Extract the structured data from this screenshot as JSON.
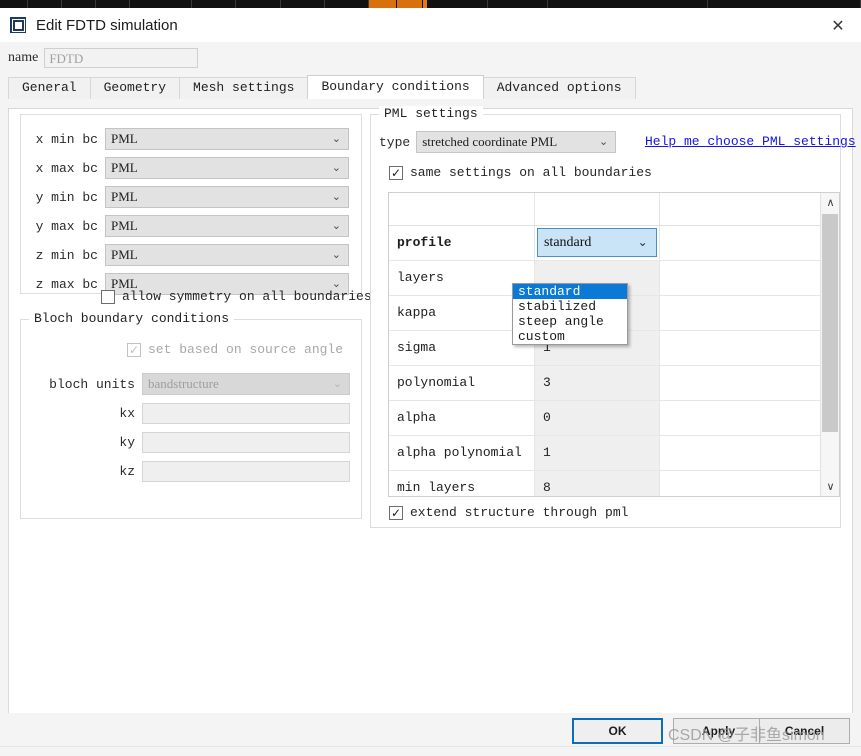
{
  "window": {
    "title": "Edit FDTD simulation",
    "app_icon": "square-window-icon",
    "close_label": "✕"
  },
  "name_row": {
    "label": "name",
    "value": "FDTD"
  },
  "tabs": [
    {
      "label": "General",
      "active": false
    },
    {
      "label": "Geometry",
      "active": false
    },
    {
      "label": "Mesh settings",
      "active": false
    },
    {
      "label": "Boundary conditions",
      "active": true
    },
    {
      "label": "Advanced options",
      "active": false
    }
  ],
  "boundary_conditions": {
    "rows": [
      {
        "label": "x min bc",
        "value": "PML"
      },
      {
        "label": "x max bc",
        "value": "PML"
      },
      {
        "label": "y min bc",
        "value": "PML"
      },
      {
        "label": "y max bc",
        "value": "PML"
      },
      {
        "label": "z min bc",
        "value": "PML"
      },
      {
        "label": "z max bc",
        "value": "PML"
      }
    ],
    "allow_symmetry": {
      "label": "allow symmetry on all boundaries",
      "checked": false,
      "mark": ""
    }
  },
  "bloch": {
    "legend": "Bloch boundary conditions",
    "set_based": {
      "label": "set based on source angle",
      "checked": true,
      "mark": "✓"
    },
    "units_label": "bloch units",
    "units_value": "bandstructure",
    "fields": [
      {
        "label": "kx",
        "value": ""
      },
      {
        "label": "ky",
        "value": ""
      },
      {
        "label": "kz",
        "value": ""
      }
    ]
  },
  "pml": {
    "legend": "PML settings",
    "type_label": "type",
    "type_value": "stretched coordinate PML",
    "help_link": "Help me choose PML settings",
    "same_settings": {
      "label": "same settings on all boundaries",
      "checked": true,
      "mark": "✓"
    },
    "table": {
      "header": [
        "",
        "",
        ""
      ],
      "rows": [
        {
          "name": "profile",
          "value": "standard",
          "is_dropdown": true
        },
        {
          "name": "layers",
          "value": ""
        },
        {
          "name": "kappa",
          "value": ""
        },
        {
          "name": "sigma",
          "value": "1"
        },
        {
          "name": "polynomial",
          "value": "3"
        },
        {
          "name": "alpha",
          "value": "0"
        },
        {
          "name": "alpha polynomial",
          "value": "1"
        },
        {
          "name": "min layers",
          "value": "8"
        }
      ]
    },
    "dropdown_options": [
      {
        "label": "standard",
        "selected": true
      },
      {
        "label": "stabilized",
        "selected": false
      },
      {
        "label": "steep angle",
        "selected": false
      },
      {
        "label": "custom",
        "selected": false
      }
    ],
    "extend_structure": {
      "label": "extend structure through pml",
      "checked": true,
      "mark": "✓"
    },
    "scrollbar": {
      "up_arrow": "∧",
      "down_arrow": "∨"
    }
  },
  "footer": {
    "ok": "OK",
    "apply": "Apply",
    "cancel": "Cancel",
    "watermark": "CSDN @子非鱼simon"
  },
  "colors": {
    "accent_blue": "#0a6ebd",
    "link_blue": "#1414e6",
    "selection_blue": "#0a7ad6",
    "cell_highlight": "#c9e3f7",
    "taskbar_orange": "#d9700e"
  }
}
